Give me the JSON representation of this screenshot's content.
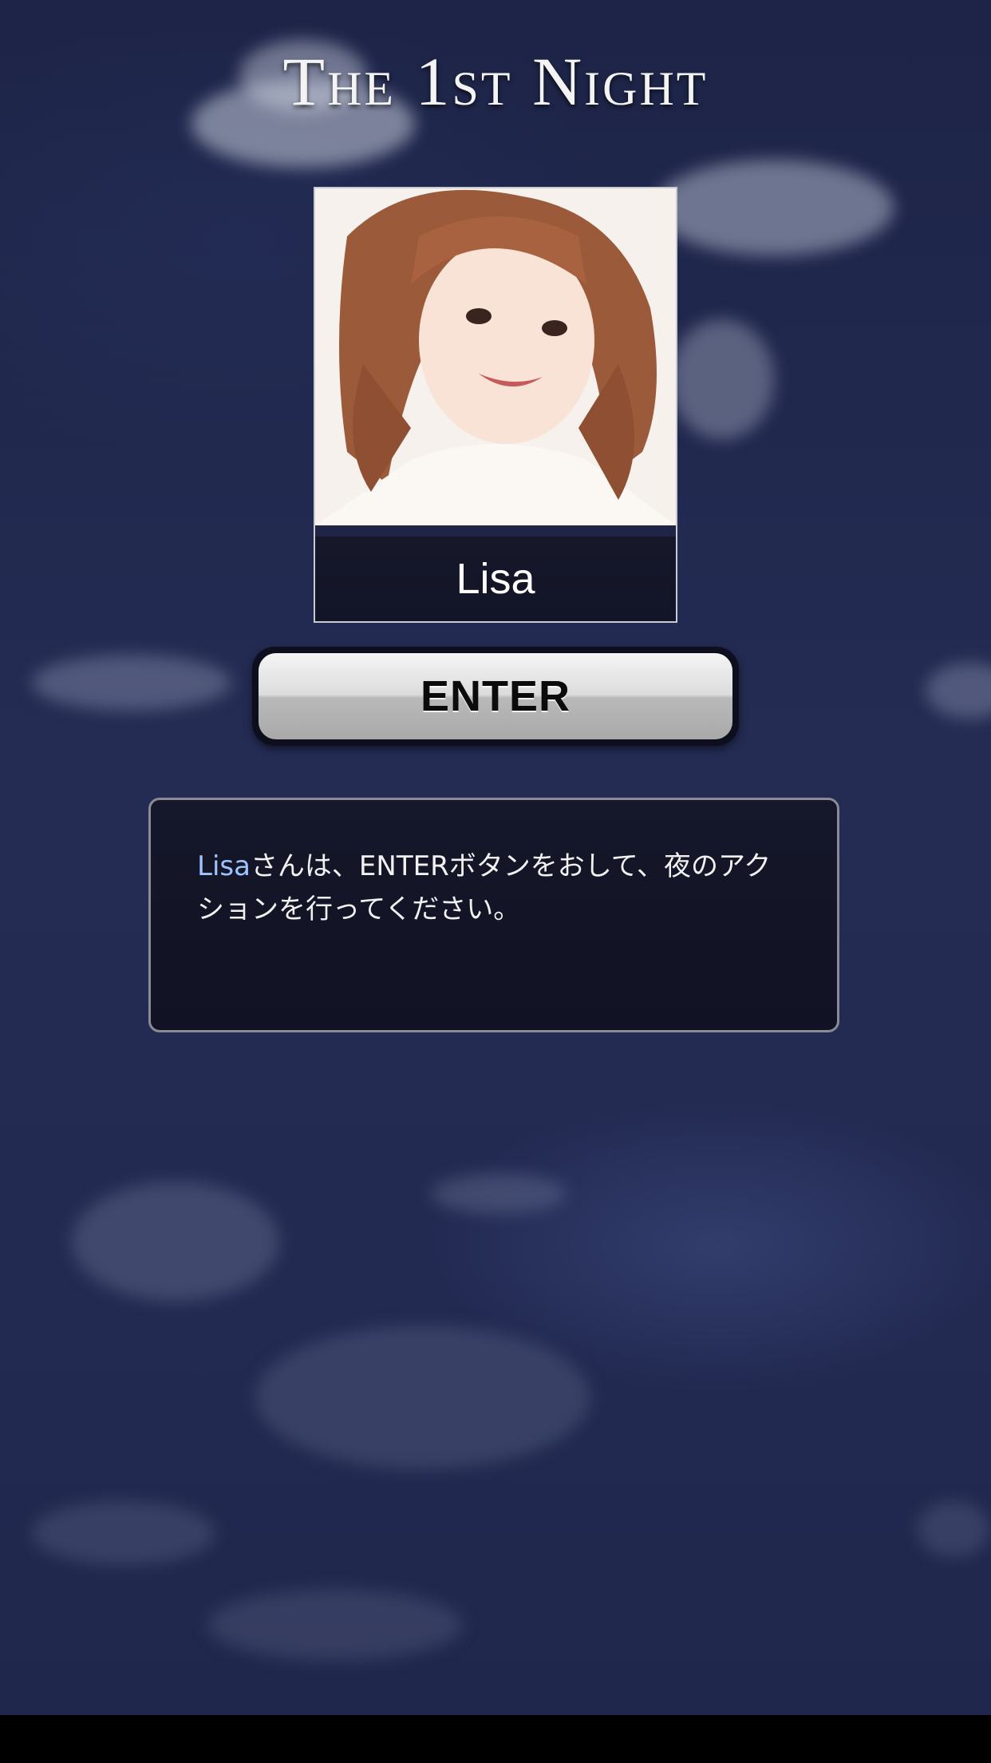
{
  "header": {
    "title": "The 1st Night"
  },
  "player_card": {
    "name": "Lisa",
    "photo_icon": "portrait-photo"
  },
  "enter_button": {
    "label": "ENTER"
  },
  "message": {
    "highlight_name": "Lisa",
    "text": "さんは、ENTERボタンをおして、夜のアクションを行ってください。",
    "highlight_color": "#9ec4ff"
  },
  "colors": {
    "sky": "#1e2648",
    "bottom_bar": "#000000",
    "button_gradient_top": "#f5f5f5",
    "button_gradient_bottom": "#a9a9a9"
  }
}
